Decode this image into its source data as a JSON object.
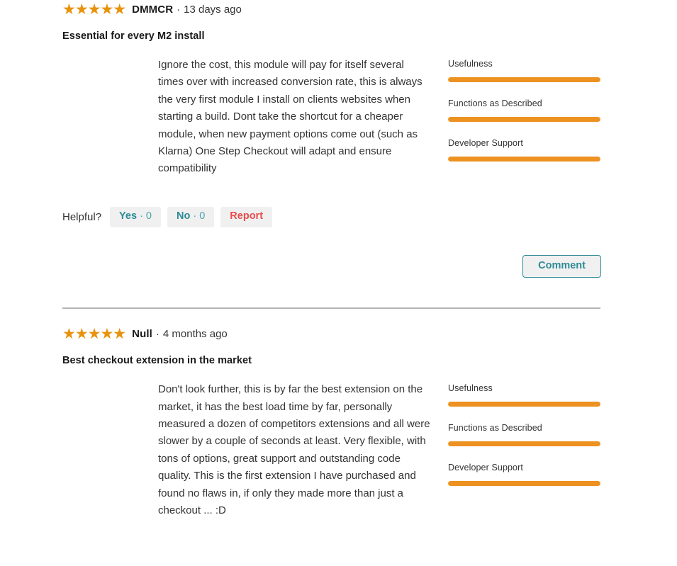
{
  "accent_colors": {
    "star": "#e8920c",
    "rating_bar": "#ed9121",
    "teal": "#2e8b96",
    "report_red": "#e74c4c",
    "button_bg": "#f0f0f0",
    "divider": "#b5b5b5"
  },
  "labels": {
    "helpful": "Helpful?",
    "yes_word": "Yes",
    "yes_count": "· 0",
    "no_word": "No",
    "no_count": "· 0",
    "report": "Report",
    "comment": "Comment",
    "separator": "·"
  },
  "reviews": [
    {
      "stars": "★★★★★",
      "rating": 5,
      "author": "DMMCR",
      "separator": "·",
      "time_ago": "13 days ago",
      "title": "Essential for every M2 install",
      "text": "Ignore the cost, this module will pay for itself several times over with increased conversion rate, this is always the very first module I install on clients websites when starting a build. Dont take the shortcut for a cheaper module, when new payment options come out (such as Klarna) One Step Checkout will adapt and ensure compatibility",
      "ratings": [
        {
          "label": "Usefulness",
          "percent": 100
        },
        {
          "label": "Functions as Described",
          "percent": 100
        },
        {
          "label": "Developer Support",
          "percent": 100
        }
      ]
    },
    {
      "stars": "★★★★★",
      "rating": 5,
      "author": "Null",
      "separator": "·",
      "time_ago": "4 months ago",
      "title": "Best checkout extension in the market",
      "text": "Don't look further, this is by far the best extension on the market, it has the best load time by far, personally measured a dozen of competitors extensions and all were slower by a couple of seconds at least. Very flexible, with tons of options, great support and outstanding code quality. This is the first extension I have purchased and found no flaws in, if only they made more than just a checkout ... :D",
      "ratings": [
        {
          "label": "Usefulness",
          "percent": 100
        },
        {
          "label": "Functions as Described",
          "percent": 100
        },
        {
          "label": "Developer Support",
          "percent": 100
        }
      ]
    }
  ]
}
